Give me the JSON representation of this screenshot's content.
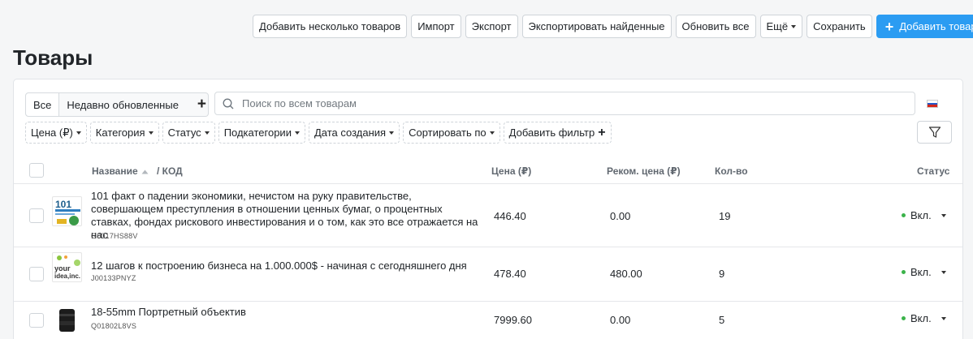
{
  "toolbar": {
    "add_multiple": "Добавить несколько товаров",
    "import": "Импорт",
    "export": "Экспорт",
    "export_found": "Экспортировать найденные",
    "refresh_all": "Обновить все",
    "more": "Ещё",
    "save": "Сохранить",
    "add_product": "Добавить товар"
  },
  "page_title": "Товары",
  "tabs": {
    "all": "Все",
    "recent": "Недавно обновленные"
  },
  "search": {
    "placeholder": "Поиск по всем товарам"
  },
  "filters": {
    "price": "Цена (₽)",
    "category": "Категория",
    "status": "Статус",
    "subcategories": "Подкатегории",
    "created": "Дата создания",
    "sort": "Сортировать по",
    "add_filter": "Добавить фильтр"
  },
  "table": {
    "headers": {
      "name": "Название",
      "code": "/ КОД",
      "price": "Цена (₽)",
      "rec_price": "Реком. цена (₽)",
      "qty": "Кол-во",
      "status": "Статус"
    },
    "rows": [
      {
        "name": "101 факт о падении экономики, нечистом на руку правительстве, совершающем преступления в отношении ценных бумаг, о процентных ставках, фондах рискового инвестирования и о том, как это все отражается на нас",
        "code": "G0017HS88V",
        "price": "446.40",
        "rec_price": "0.00",
        "qty": "19",
        "status": "Вкл.",
        "thumb_icon": "book-cover-101-economics-icon"
      },
      {
        "name": "12 шагов к построению бизнеса на 1.000.000$ - начиная с сегодняшнего дня",
        "code": "J00133PNYZ",
        "price": "478.40",
        "rec_price": "480.00",
        "qty": "9",
        "status": "Вкл.",
        "thumb_icon": "book-cover-your-idea-inc-icon"
      },
      {
        "name": "18-55mm Портретный объектив",
        "code": "Q01802L8VS",
        "price": "7999.60",
        "rec_price": "0.00",
        "qty": "5",
        "status": "Вкл.",
        "thumb_icon": "camera-lens-icon"
      }
    ]
  },
  "colors": {
    "primary": "#2b9cf2",
    "status_on": "#3bb34a"
  }
}
